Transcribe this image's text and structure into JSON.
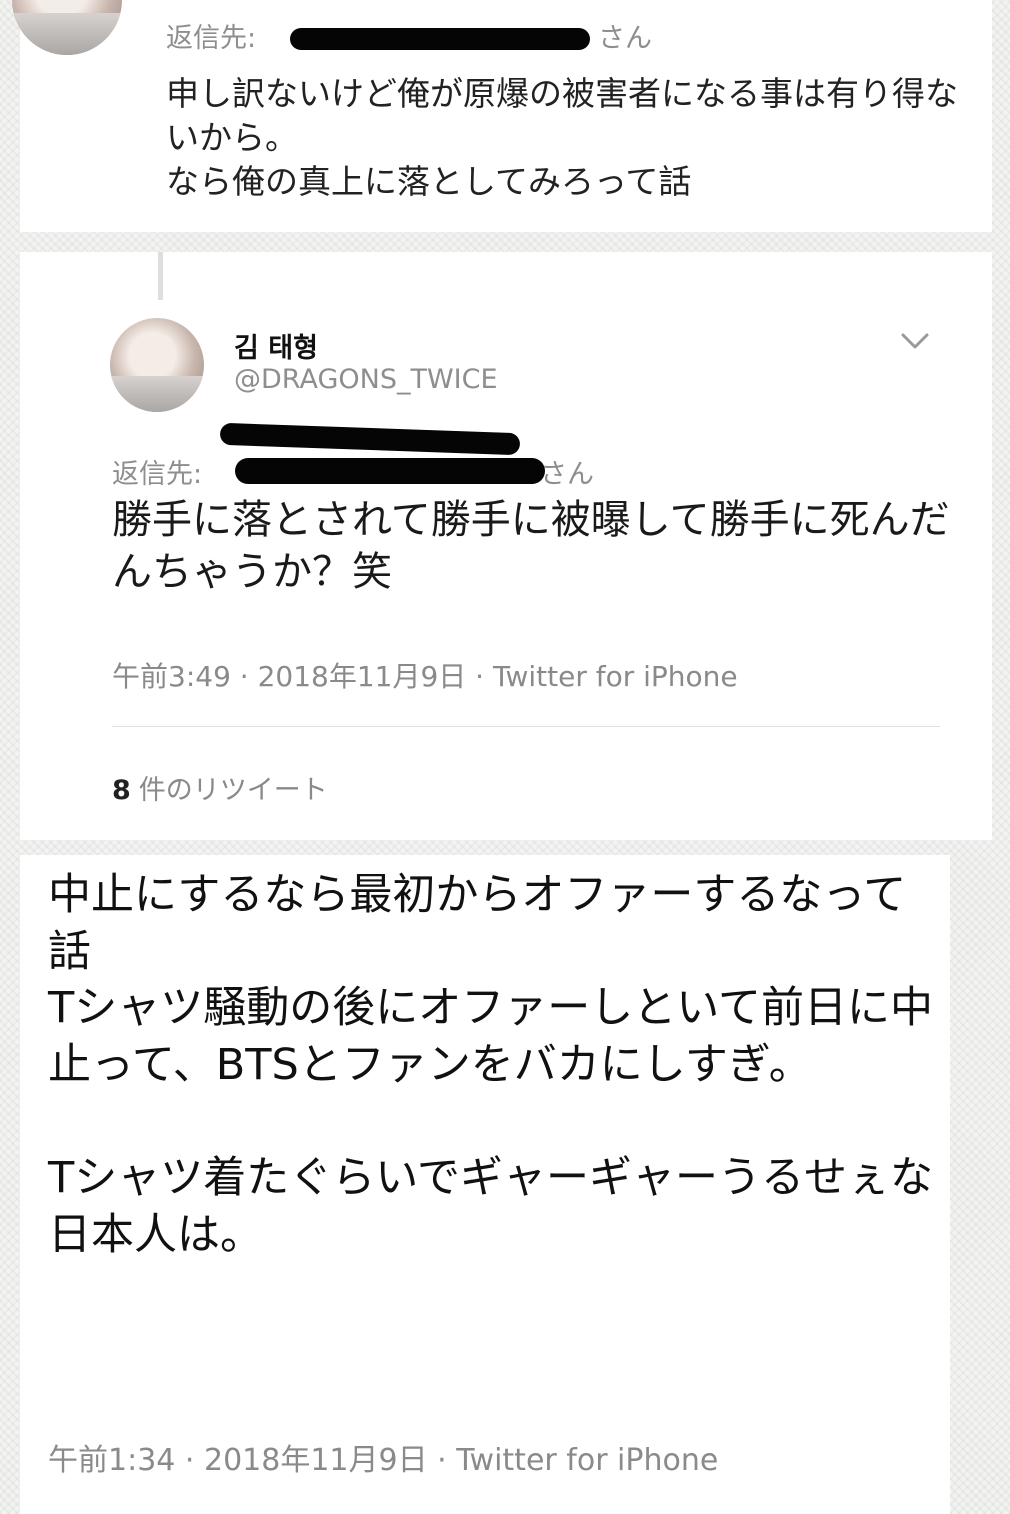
{
  "tweet1": {
    "reply_prefix": "返信先:",
    "reply_suffix": "さん",
    "text": "申し訳ないけど俺が原爆の被害者になる事は有り得ないから。\nなら俺の真上に落としてみろって話"
  },
  "tweet2": {
    "display_name": "김 태형",
    "handle": "@DRAGONS_TWICE",
    "reply_prefix": "返信先:",
    "reply_suffix": "さん",
    "text": "勝手に落とされて勝手に被曝して勝手に死んだんちゃうか？笑",
    "meta": "午前3:49 · 2018年11月9日 · Twitter for iPhone",
    "retweet_count": "8",
    "retweet_label": "件のリツイート",
    "menu_icon": "chevron-down-icon"
  },
  "tweet3": {
    "text": "中止にするなら最初からオファーするなって話\nTシャツ騒動の後にオファーしといて前日に中止って、BTSとファンをバカにしすぎ。\n\nTシャツ着たぐらいでギャーギャーうるせぇな日本人は。",
    "meta": "午前1:34 · 2018年11月9日 · Twitter for iPhone"
  }
}
